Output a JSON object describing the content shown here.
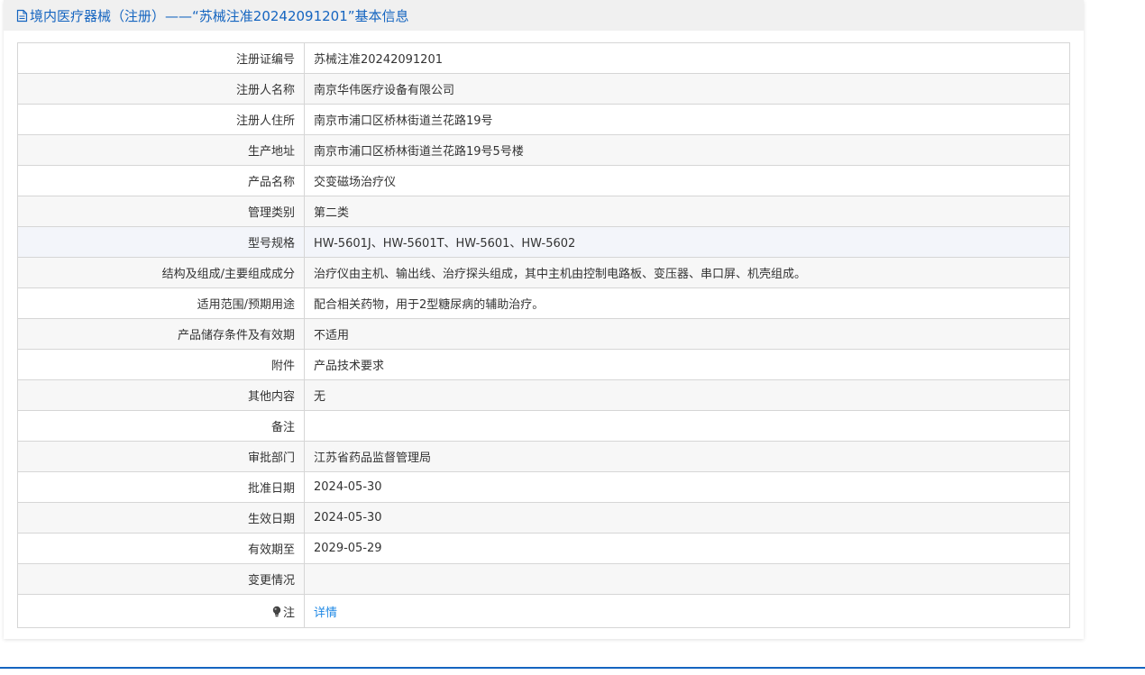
{
  "header": {
    "title": "境内医疗器械（注册）——“苏械注准20242091201”基本信息",
    "icon": "document-icon"
  },
  "rows": [
    {
      "key": "注册证编号",
      "value": "苏械注准20242091201"
    },
    {
      "key": "注册人名称",
      "value": "南京华伟医疗设备有限公司"
    },
    {
      "key": "注册人住所",
      "value": "南京市浦口区桥林街道兰花路19号"
    },
    {
      "key": "生产地址",
      "value": "南京市浦口区桥林街道兰花路19号5号楼"
    },
    {
      "key": "产品名称",
      "value": "交变磁场治疗仪"
    },
    {
      "key": "管理类别",
      "value": "第二类"
    },
    {
      "key": "型号规格",
      "value": "HW-5601J、HW-5601T、HW-5601、HW-5602"
    },
    {
      "key": "结构及组成/主要组成成分",
      "value": "治疗仪由主机、输出线、治疗探头组成，其中主机由控制电路板、变压器、串口屏、机壳组成。"
    },
    {
      "key": "适用范围/预期用途",
      "value": "配合相关药物，用于2型糖尿病的辅助治疗。"
    },
    {
      "key": "产品储存条件及有效期",
      "value": "不适用"
    },
    {
      "key": "附件",
      "value": "产品技术要求"
    },
    {
      "key": "其他内容",
      "value": "无"
    },
    {
      "key": "备注",
      "value": ""
    },
    {
      "key": "审批部门",
      "value": "江苏省药品监督管理局"
    },
    {
      "key": "批准日期",
      "value": "2024-05-30"
    },
    {
      "key": "生效日期",
      "value": "2024-05-30"
    },
    {
      "key": "有效期至",
      "value": "2029-05-29"
    },
    {
      "key": "变更情况",
      "value": ""
    }
  ],
  "note": {
    "icon": "lightbulb-icon",
    "label": "注",
    "link_text": "详情"
  },
  "colors": {
    "accent": "#1565c0",
    "link": "#1e88e5",
    "border": "#d6d6d6"
  }
}
